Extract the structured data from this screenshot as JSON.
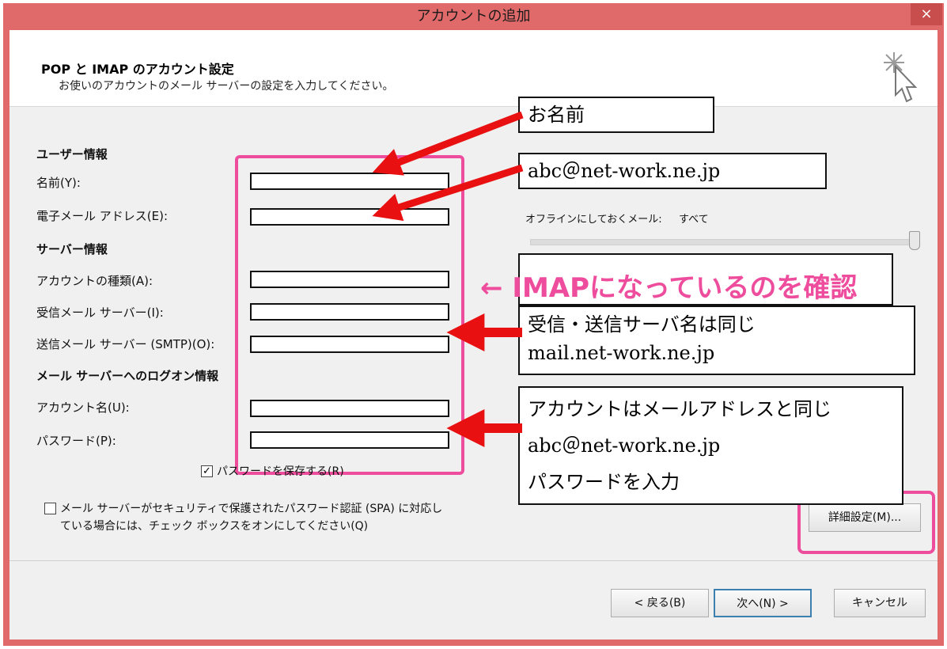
{
  "window": {
    "title": "アカウントの追加",
    "close_symbol": "×"
  },
  "header": {
    "title": "POP と IMAP のアカウント設定",
    "subtitle": "お使いのアカウントのメール サーバーの設定を入力してください。",
    "icon": "wizard-cursor-icon"
  },
  "form": {
    "user_section": "ユーザー情報",
    "name_label": "名前(Y):",
    "email_label": "電子メール アドレス(E):",
    "server_section": "サーバー情報",
    "account_type_label": "アカウントの種類(A):",
    "incoming_label": "受信メール サーバー(I):",
    "outgoing_label": "送信メール サーバー (SMTP)(O):",
    "logon_section": "メール サーバーへのログオン情報",
    "account_name_label": "アカウント名(U):",
    "password_label": "パスワード(P):",
    "remember_password_label": "パスワードを保存する(R)",
    "spa_label_line1": "メール サーバーがセキュリティで保護されたパスワード認証 (SPA) に対応し",
    "spa_label_line2": "ている場合には、チェック ボックスをオンにしてください(Q)"
  },
  "offline": {
    "label": "オフラインにしておくメール:",
    "value": "すべて"
  },
  "buttons": {
    "advanced": "詳細設定(M)...",
    "back": "< 戻る(B)",
    "next": "次へ(N) >",
    "cancel": "キャンセル"
  },
  "annotations": {
    "name_note": "お名前",
    "email_note": "abc＠net-work.ne.jp",
    "imap_note": "← IMAPになっているのを確認",
    "server_note_line1": "受信・送信サーバ名は同じ",
    "server_note_line2": "mail.net-work.ne.jp",
    "account_note_line1": "アカウントはメールアドレスと同じ",
    "account_note_line2": "abc＠net-work.ne.jp",
    "account_note_line3": "パスワードを入力"
  },
  "colors": {
    "titlebar": "#e06a6a",
    "highlight_pink": "#ee4c9c",
    "arrow_red": "#e81010"
  }
}
